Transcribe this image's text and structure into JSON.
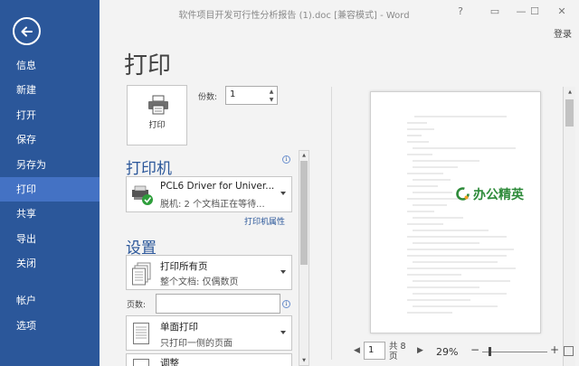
{
  "window": {
    "title": "软件项目开发可行性分析报告 (1).doc [兼容模式] - Word",
    "help": "?",
    "restore_ribbon": "▭",
    "minimize": "—",
    "maximize": "☐",
    "close": "✕",
    "login": "登录"
  },
  "sidebar": {
    "items": [
      {
        "label": "信息"
      },
      {
        "label": "新建"
      },
      {
        "label": "打开"
      },
      {
        "label": "保存"
      },
      {
        "label": "另存为"
      },
      {
        "label": "打印"
      },
      {
        "label": "共享"
      },
      {
        "label": "导出"
      },
      {
        "label": "关闭"
      },
      {
        "label": "帐户"
      },
      {
        "label": "选项"
      }
    ],
    "active": "打印",
    "color": "#2b579a",
    "active_color": "#4472c4"
  },
  "print": {
    "page_title": "打印",
    "button_label": "打印",
    "copies_label": "份数:",
    "copies_value": "1"
  },
  "printer": {
    "heading": "打印机",
    "name": "PCL6 Driver for Univer...",
    "status": "脱机: 2 个文档正在等待...",
    "properties_link": "打印机属性"
  },
  "settings": {
    "heading": "设置",
    "range_main": "打印所有页",
    "range_sub": "整个文档: 仅偶数页",
    "pages_label": "页数:",
    "pages_value": "",
    "sides_main": "单面打印",
    "sides_sub": "只打印一侧的页面",
    "collate_main": "调整"
  },
  "preview": {
    "brand": "办公精英",
    "current_page": "1",
    "total_pages": "共 8 页",
    "zoom": "29%",
    "zoom_level": 0.29
  }
}
